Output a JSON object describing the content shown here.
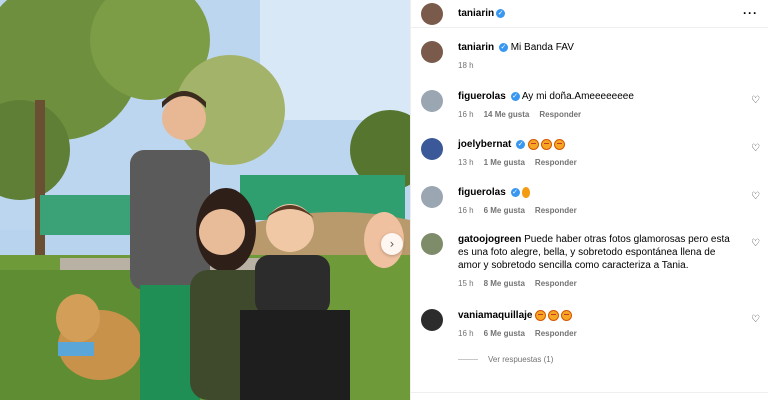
{
  "post": {
    "username": "taniarin",
    "caption": "Mi Banda FAV",
    "caption_time": "18 h",
    "more_icon": "more-horizontal-icon"
  },
  "comments": [
    {
      "username": "figuerolas",
      "verified": true,
      "text": "Ay mi doña.Ameeeeeeee",
      "time": "16 h",
      "likes": "14 Me gusta",
      "reply": "Responder",
      "avatar_color": "#9aa6b2"
    },
    {
      "username": "joelybernat",
      "verified": true,
      "text": "",
      "emojis": 3,
      "time": "13 h",
      "likes": "1 Me gusta",
      "reply": "Responder",
      "avatar_color": "#3b5998"
    },
    {
      "username": "figuerolas",
      "verified": true,
      "text": "",
      "flame": true,
      "time": "16 h",
      "likes": "6 Me gusta",
      "reply": "Responder",
      "avatar_color": "#9aa6b2"
    },
    {
      "username": "gatoojogreen",
      "verified": false,
      "text": "Puede haber otras fotos glamorosas pero esta es una foto alegre, bella, y sobretodo espontánea llena de amor y sobretodo sencilla como caracteriza a Tania.",
      "time": "15 h",
      "likes": "8 Me gusta",
      "reply": "Responder",
      "avatar_color": "#7f8c6a"
    },
    {
      "username": "vaniamaquillaje",
      "verified": false,
      "text": "",
      "emojis": 3,
      "time": "16 h",
      "likes": "6 Me gusta",
      "reply": "Responder",
      "avatar_color": "#2c2c2c"
    }
  ],
  "view_replies": "Ver respuestas (1)",
  "colors": {
    "accent": "#3897f0",
    "muted": "#737373"
  }
}
